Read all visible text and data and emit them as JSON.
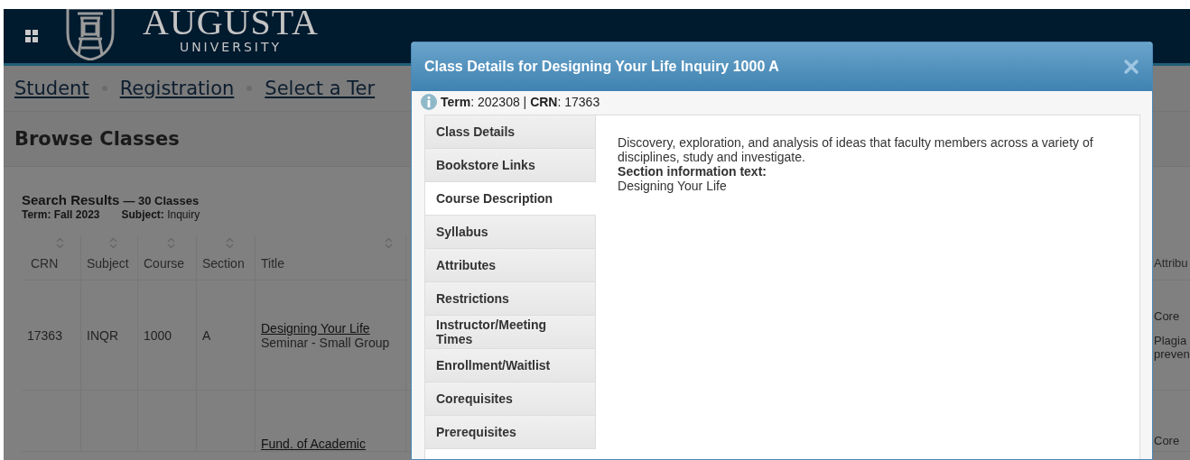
{
  "header": {
    "logo_name": "AUGUSTA",
    "logo_sub": "UNIVERSITY"
  },
  "breadcrumbs": [
    "Student",
    "Registration",
    "Select a Ter"
  ],
  "page_title": "Browse Classes",
  "results": {
    "heading": "Search Results",
    "count": "— 30 Classes",
    "term": "Term: Fall 2023",
    "subject": "**Subject:** Inquiry"
  },
  "table": {
    "columns": [
      {
        "label": "CRN",
        "sortable": true
      },
      {
        "label": "Subject",
        "sortable": true
      },
      {
        "label": "Course",
        "sortable": true
      },
      {
        "label": "Section",
        "sortable": true
      },
      {
        "label": "Title",
        "sortable": true
      },
      {
        "label": "Attribu",
        "sortable": false
      }
    ],
    "rows": [
      {
        "crn": "17363",
        "subject": "INQR",
        "course": "1000",
        "section": "A",
        "title_link": "Designing Your Life",
        "title_rest": "Seminar - Small Group",
        "attributes": [
          "Core",
          "Plagia\npreven"
        ]
      },
      {
        "title_link": "Fund. of Academic",
        "attributes": [
          "Core"
        ]
      }
    ]
  },
  "modal": {
    "title": "Class Details for Designing Your Life Inquiry 1000 A",
    "info": "**Term**: 202308 | **CRN**: 17363",
    "tabs": [
      {
        "label": "Class Details",
        "selected": false
      },
      {
        "label": "Bookstore Links",
        "selected": false
      },
      {
        "label": "Course Description",
        "selected": true
      },
      {
        "label": "Syllabus",
        "selected": false
      },
      {
        "label": "Attributes",
        "selected": false
      },
      {
        "label": "Restrictions",
        "selected": false
      },
      {
        "label": "Instructor/Meeting Times",
        "selected": false
      },
      {
        "label": "Enrollment/Waitlist",
        "selected": false
      },
      {
        "label": "Corequisites",
        "selected": false
      },
      {
        "label": "Prerequisites",
        "selected": false
      }
    ],
    "description": "Discovery, exploration, and analysis of ideas that faculty members across a variety of disciplines, study and investigate.",
    "section_label": "Section information text:",
    "section_text": "Designing Your Life"
  }
}
